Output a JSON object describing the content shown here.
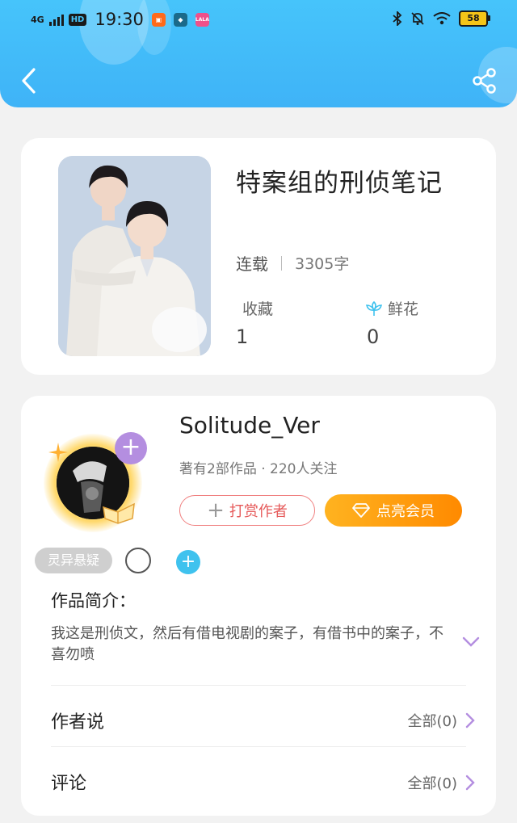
{
  "status_bar": {
    "network": "4G",
    "hd": "HD",
    "time": "19:30",
    "app_icons": [
      "orange-app-icon",
      "blue-app-icon",
      "pink-app-icon"
    ],
    "app_icon_text": "LALA",
    "battery": "58"
  },
  "header": {
    "back_icon": "chevron-left-icon",
    "share_icon": "share-icon"
  },
  "book": {
    "title": "特案组的刑侦笔记",
    "status": "连载",
    "word_count": "3305字",
    "favorites_label": "收藏",
    "favorites_value": "1",
    "flowers_label": "鲜花",
    "flowers_value": "0"
  },
  "author": {
    "name": "Solitude_Ver",
    "meta": "著有2部作品 · 220人关注",
    "reward_label": "打赏作者",
    "vip_label": "点亮会员"
  },
  "tags": {
    "genre": "灵异悬疑"
  },
  "intro": {
    "title": "作品简介：",
    "text": "我这是刑侦文，然后有借电视剧的案子，有借书中的案子，不喜勿喷"
  },
  "rows": [
    {
      "title": "作者说",
      "more": "全部(0)"
    },
    {
      "title": "评论",
      "more": "全部(0)"
    }
  ],
  "colors": {
    "header_blue": "#46c4fb",
    "vip_orange": "#ff9a10",
    "reward_red": "#e65a5a",
    "accent_purple": "#b48ee0",
    "tag_add_blue": "#3fc2ee"
  }
}
